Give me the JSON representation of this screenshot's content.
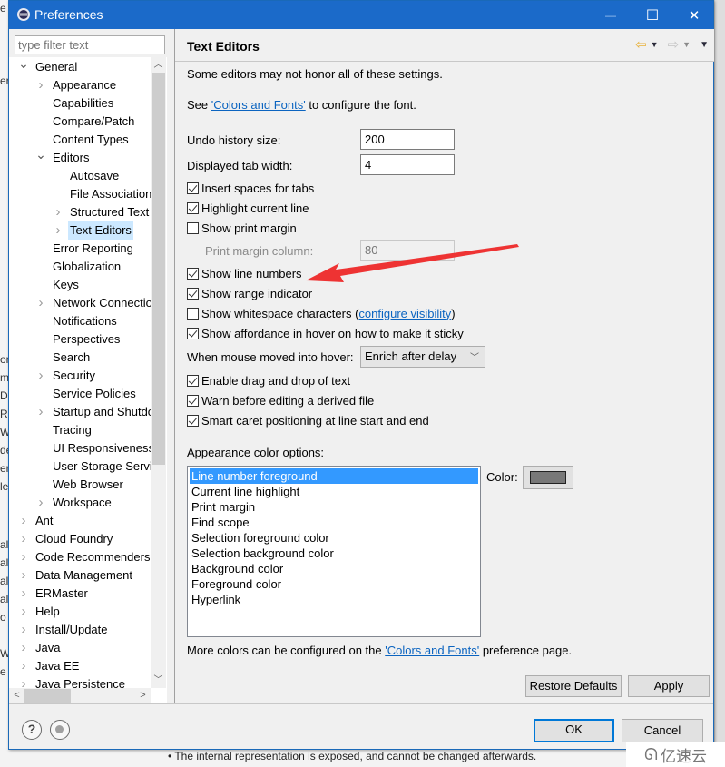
{
  "background": {
    "left_fragments": [
      "e",
      "",
      "",
      "er",
      "or",
      "m",
      "Da",
      "Re",
      "W",
      "de",
      "er",
      "le",
      "al",
      "al",
      "al",
      "al",
      "o",
      "W",
      "e"
    ],
    "bottom_text": "• The internal representation is exposed, and cannot be changed afterwards."
  },
  "window": {
    "title": "Preferences",
    "app_icon": "eclipse-gear-icon",
    "controls": {
      "minimize": "—",
      "maximize": "☐",
      "close": "✕"
    }
  },
  "filter": {
    "placeholder": "type filter text",
    "value": ""
  },
  "tree": {
    "items": [
      {
        "label": "General",
        "level": 0,
        "twisty": "expanded"
      },
      {
        "label": "Appearance",
        "level": 1,
        "twisty": "collapsed"
      },
      {
        "label": "Capabilities",
        "level": 1,
        "twisty": "none"
      },
      {
        "label": "Compare/Patch",
        "level": 1,
        "twisty": "none"
      },
      {
        "label": "Content Types",
        "level": 1,
        "twisty": "none"
      },
      {
        "label": "Editors",
        "level": 1,
        "twisty": "expanded"
      },
      {
        "label": "Autosave",
        "level": 2,
        "twisty": "none"
      },
      {
        "label": "File Associations",
        "level": 2,
        "twisty": "none"
      },
      {
        "label": "Structured Text Editors",
        "level": 2,
        "twisty": "collapsed"
      },
      {
        "label": "Text Editors",
        "level": 2,
        "twisty": "collapsed",
        "selected": true
      },
      {
        "label": "Error Reporting",
        "level": 1,
        "twisty": "none"
      },
      {
        "label": "Globalization",
        "level": 1,
        "twisty": "none"
      },
      {
        "label": "Keys",
        "level": 1,
        "twisty": "none"
      },
      {
        "label": "Network Connections",
        "level": 1,
        "twisty": "collapsed"
      },
      {
        "label": "Notifications",
        "level": 1,
        "twisty": "none"
      },
      {
        "label": "Perspectives",
        "level": 1,
        "twisty": "none"
      },
      {
        "label": "Search",
        "level": 1,
        "twisty": "none"
      },
      {
        "label": "Security",
        "level": 1,
        "twisty": "collapsed"
      },
      {
        "label": "Service Policies",
        "level": 1,
        "twisty": "none"
      },
      {
        "label": "Startup and Shutdown",
        "level": 1,
        "twisty": "collapsed"
      },
      {
        "label": "Tracing",
        "level": 1,
        "twisty": "none"
      },
      {
        "label": "UI Responsiveness",
        "level": 1,
        "twisty": "none"
      },
      {
        "label": "User Storage Service",
        "level": 1,
        "twisty": "none"
      },
      {
        "label": "Web Browser",
        "level": 1,
        "twisty": "none"
      },
      {
        "label": "Workspace",
        "level": 1,
        "twisty": "collapsed"
      },
      {
        "label": "Ant",
        "level": 0,
        "twisty": "collapsed"
      },
      {
        "label": "Cloud Foundry",
        "level": 0,
        "twisty": "collapsed"
      },
      {
        "label": "Code Recommenders",
        "level": 0,
        "twisty": "collapsed"
      },
      {
        "label": "Data Management",
        "level": 0,
        "twisty": "collapsed"
      },
      {
        "label": "ERMaster",
        "level": 0,
        "twisty": "collapsed"
      },
      {
        "label": "Help",
        "level": 0,
        "twisty": "collapsed"
      },
      {
        "label": "Install/Update",
        "level": 0,
        "twisty": "collapsed"
      },
      {
        "label": "Java",
        "level": 0,
        "twisty": "collapsed"
      },
      {
        "label": "Java EE",
        "level": 0,
        "twisty": "collapsed"
      },
      {
        "label": "Java Persistence",
        "level": 0,
        "twisty": "collapsed"
      }
    ],
    "scroll_up": "^",
    "scroll_down": "v",
    "scroll_left": "<",
    "scroll_right": ">"
  },
  "page": {
    "title": "Text Editors",
    "nav": {
      "back": "⇦",
      "forward": "⇨",
      "dropdown": "▼"
    },
    "note": "Some editors may not honor all of these settings.",
    "font_line": {
      "prefix": "See ",
      "link": "'Colors and Fonts'",
      "suffix": " to configure the font."
    },
    "undo_history": {
      "label": "Undo history size:",
      "value": "200"
    },
    "tab_width": {
      "label": "Displayed tab width:",
      "value": "4"
    },
    "checkboxes_a": [
      {
        "label": "Insert spaces for tabs",
        "checked": true
      },
      {
        "label": "Highlight current line",
        "checked": true
      },
      {
        "label": "Show print margin",
        "checked": false
      }
    ],
    "print_margin": {
      "label": "Print margin column:",
      "value": "80",
      "enabled": false
    },
    "checkboxes_b": [
      {
        "label": "Show line numbers",
        "checked": true
      },
      {
        "label": "Show range indicator",
        "checked": true
      },
      {
        "label": "Show whitespace characters (",
        "checked": false,
        "link": "configure visibility",
        "after": ")"
      },
      {
        "label": "Show affordance in hover on how to make it sticky",
        "checked": true
      }
    ],
    "hover": {
      "label": "When mouse moved into hover:",
      "value": "Enrich after delay"
    },
    "checkboxes_c": [
      {
        "label": "Enable drag and drop of text",
        "checked": true
      },
      {
        "label": "Warn before editing a derived file",
        "checked": true
      },
      {
        "label": "Smart caret positioning at line start and end",
        "checked": true
      }
    ],
    "appearance": {
      "label": "Appearance color options:",
      "items": [
        "Line number foreground",
        "Current line highlight",
        "Print margin",
        "Find scope",
        "Selection foreground color",
        "Selection background color",
        "Background color",
        "Foreground color",
        "Hyperlink"
      ],
      "selected_index": 0,
      "color_label": "Color:",
      "color_value": "#787878"
    },
    "more_colors": {
      "prefix": "More colors can be configured on the ",
      "link": "'Colors and Fonts'",
      "suffix": " preference page."
    },
    "restore_defaults": "Restore Defaults",
    "apply": "Apply"
  },
  "footer": {
    "help_icon": "?",
    "ok": "OK",
    "cancel": "Cancel"
  },
  "annotation": {
    "color": "#ee3333",
    "target": "Show line numbers"
  },
  "watermark": {
    "logo": "ᘏ",
    "text": "亿速云"
  }
}
